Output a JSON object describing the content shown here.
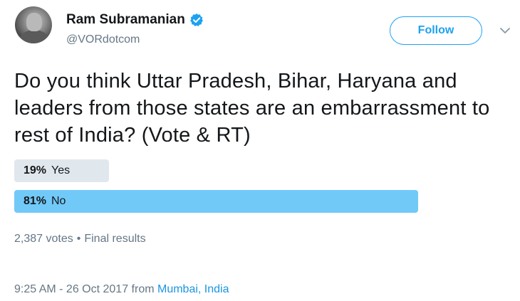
{
  "author": {
    "display_name": "Ram Subramanian",
    "handle": "@VORdotcom",
    "verified": true
  },
  "follow_button": {
    "label": "Follow"
  },
  "tweet": {
    "text": "Do you think Uttar Pradesh, Bihar, Haryana and leaders from those states are an embarrassment to rest of India? (Vote & RT)"
  },
  "poll": {
    "options": [
      {
        "percent_label": "19%",
        "label": "Yes",
        "fraction": 0.19,
        "winner": false
      },
      {
        "percent_label": "81%",
        "label": "No",
        "fraction": 0.81,
        "winner": true
      }
    ],
    "votes_label": "2,387 votes",
    "separator": "•",
    "status": "Final results"
  },
  "timestamp": {
    "time_date": "9:25 AM - 26 Oct 2017 from",
    "place": "Mumbai, India"
  },
  "colors": {
    "accent": "#1da1f2",
    "winner_bar": "#71c9f8",
    "loser_bar": "#e1e8ed",
    "secondary_text": "#657786"
  }
}
